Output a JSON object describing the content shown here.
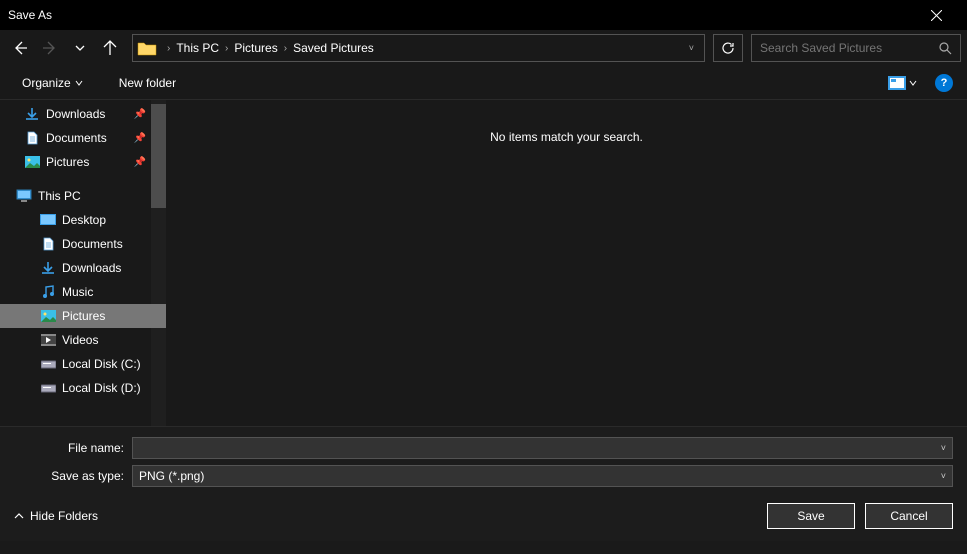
{
  "window": {
    "title": "Save As"
  },
  "nav": {
    "breadcrumbs": [
      "This PC",
      "Pictures",
      "Saved Pictures"
    ],
    "search_placeholder": "Search Saved Pictures"
  },
  "toolbar": {
    "organize": "Organize",
    "new_folder": "New folder"
  },
  "sidebar": {
    "quick": [
      {
        "label": "Downloads",
        "icon": "download",
        "pinned": true
      },
      {
        "label": "Documents",
        "icon": "document",
        "pinned": true
      },
      {
        "label": "Pictures",
        "icon": "pictures",
        "pinned": true
      }
    ],
    "this_pc_label": "This PC",
    "this_pc": [
      {
        "label": "Desktop",
        "icon": "desktop"
      },
      {
        "label": "Documents",
        "icon": "document"
      },
      {
        "label": "Downloads",
        "icon": "download"
      },
      {
        "label": "Music",
        "icon": "music"
      },
      {
        "label": "Pictures",
        "icon": "pictures",
        "selected": true
      },
      {
        "label": "Videos",
        "icon": "videos"
      },
      {
        "label": "Local Disk (C:)",
        "icon": "disk"
      },
      {
        "label": "Local Disk (D:)",
        "icon": "disk"
      }
    ]
  },
  "content": {
    "empty_message": "No items match your search."
  },
  "form": {
    "filename_label": "File name:",
    "filename_value": "",
    "type_label": "Save as type:",
    "type_value": "PNG (*.png)"
  },
  "buttons": {
    "hide_folders": "Hide Folders",
    "save": "Save",
    "cancel": "Cancel"
  }
}
